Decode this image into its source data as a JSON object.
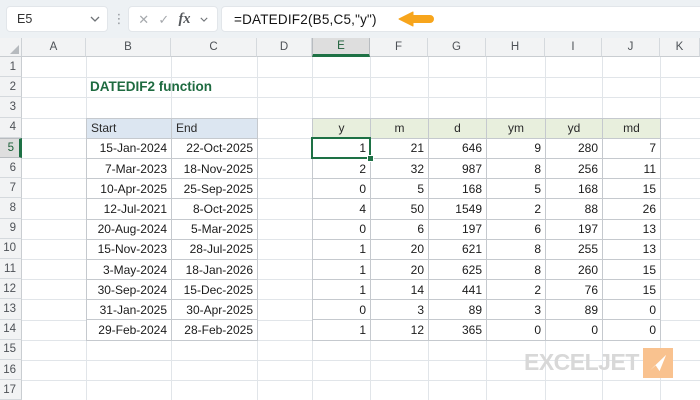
{
  "formula_bar": {
    "name_box": "E5",
    "formula": "=DATEDIF2(B5,C5,\"y\")",
    "cancel": "✕",
    "enter": "✓",
    "fx": "fx"
  },
  "title": "DATEDIF2 function",
  "grid": {
    "column_headers": [
      "A",
      "B",
      "C",
      "D",
      "E",
      "F",
      "G",
      "H",
      "I",
      "J",
      "K"
    ],
    "selected_column": "E",
    "row_headers": [
      "1",
      "2",
      "3",
      "4",
      "5",
      "6",
      "7",
      "8",
      "9",
      "10",
      "11",
      "12",
      "13",
      "14",
      "15",
      "16",
      "17"
    ],
    "selected_row": "5",
    "selected_cell": "E5"
  },
  "dates_table": {
    "headers": [
      "Start",
      "End"
    ],
    "rows": [
      [
        "15-Jan-2024",
        "22-Oct-2025"
      ],
      [
        "7-Mar-2023",
        "18-Nov-2025"
      ],
      [
        "10-Apr-2025",
        "25-Sep-2025"
      ],
      [
        "12-Jul-2021",
        "8-Oct-2025"
      ],
      [
        "20-Aug-2024",
        "5-Mar-2025"
      ],
      [
        "15-Nov-2023",
        "28-Jul-2025"
      ],
      [
        "3-May-2024",
        "18-Jan-2026"
      ],
      [
        "30-Sep-2024",
        "15-Dec-2025"
      ],
      [
        "31-Jan-2025",
        "30-Apr-2025"
      ],
      [
        "29-Feb-2024",
        "28-Feb-2025"
      ]
    ]
  },
  "results_table": {
    "headers": [
      "y",
      "m",
      "d",
      "ym",
      "yd",
      "md"
    ],
    "rows": [
      [
        "1",
        "21",
        "646",
        "9",
        "280",
        "7"
      ],
      [
        "2",
        "32",
        "987",
        "8",
        "256",
        "11"
      ],
      [
        "0",
        "5",
        "168",
        "5",
        "168",
        "15"
      ],
      [
        "4",
        "50",
        "1549",
        "2",
        "88",
        "26"
      ],
      [
        "0",
        "6",
        "197",
        "6",
        "197",
        "13"
      ],
      [
        "1",
        "20",
        "621",
        "8",
        "255",
        "13"
      ],
      [
        "1",
        "20",
        "625",
        "8",
        "260",
        "15"
      ],
      [
        "1",
        "14",
        "441",
        "2",
        "76",
        "15"
      ],
      [
        "0",
        "3",
        "89",
        "3",
        "89",
        "0"
      ],
      [
        "1",
        "12",
        "365",
        "0",
        "0",
        "0"
      ]
    ]
  },
  "logo": {
    "text": "EXCELJET"
  },
  "colors": {
    "accent_green": "#1e7145",
    "title_green": "#1e6b40",
    "arrow_orange": "#f7a51c",
    "dates_header_fill": "#dce6f1",
    "results_header_fill": "#e8efdd",
    "logo_gray": "#d8d8d8",
    "logo_orange": "#f9c28f"
  }
}
